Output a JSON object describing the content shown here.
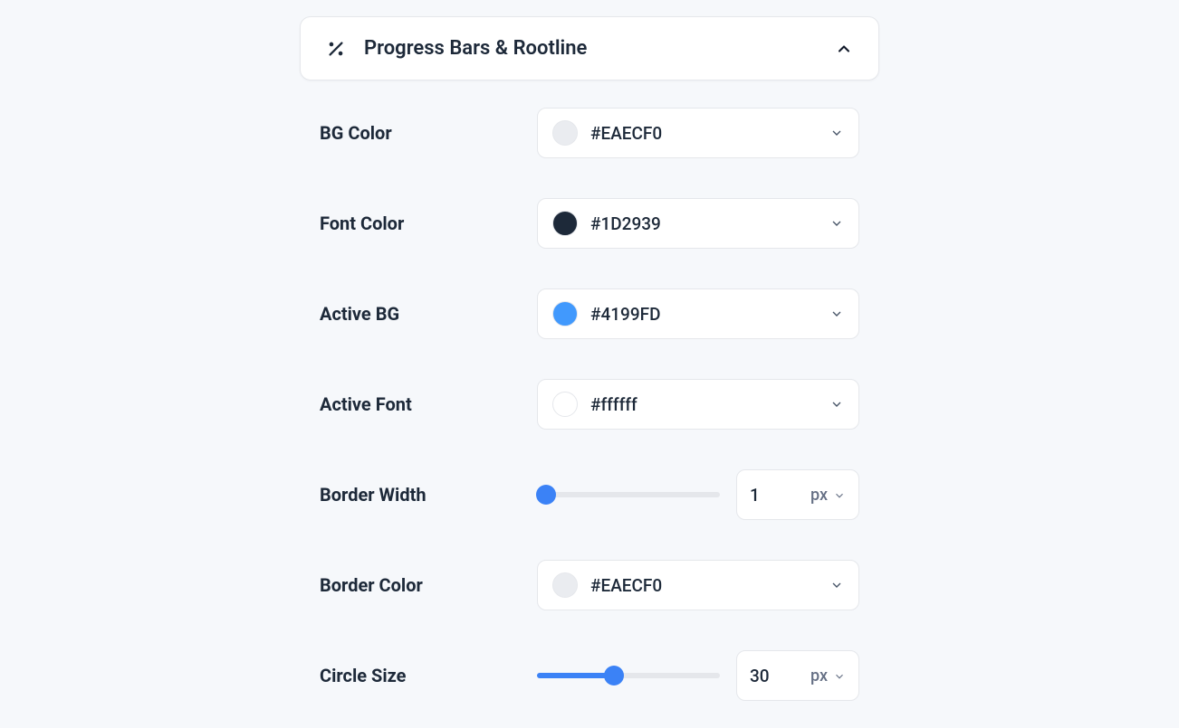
{
  "section": {
    "title": "Progress Bars & Rootline"
  },
  "fields": {
    "bg_color": {
      "label": "BG Color",
      "value": "#EAECF0",
      "swatch": "#EAECF0"
    },
    "font_color": {
      "label": "Font Color",
      "value": "#1D2939",
      "swatch": "#1D2939"
    },
    "active_bg": {
      "label": "Active BG",
      "value": "#4199FD",
      "swatch": "#4199FD"
    },
    "active_font": {
      "label": "Active Font",
      "value": "#ffffff",
      "swatch": "#ffffff"
    },
    "border_width": {
      "label": "Border Width",
      "value": "1",
      "unit": "px",
      "percent": 5
    },
    "border_color": {
      "label": "Border Color",
      "value": "#EAECF0",
      "swatch": "#EAECF0"
    },
    "circle_size": {
      "label": "Circle Size",
      "value": "30",
      "unit": "px",
      "percent": 42
    }
  }
}
